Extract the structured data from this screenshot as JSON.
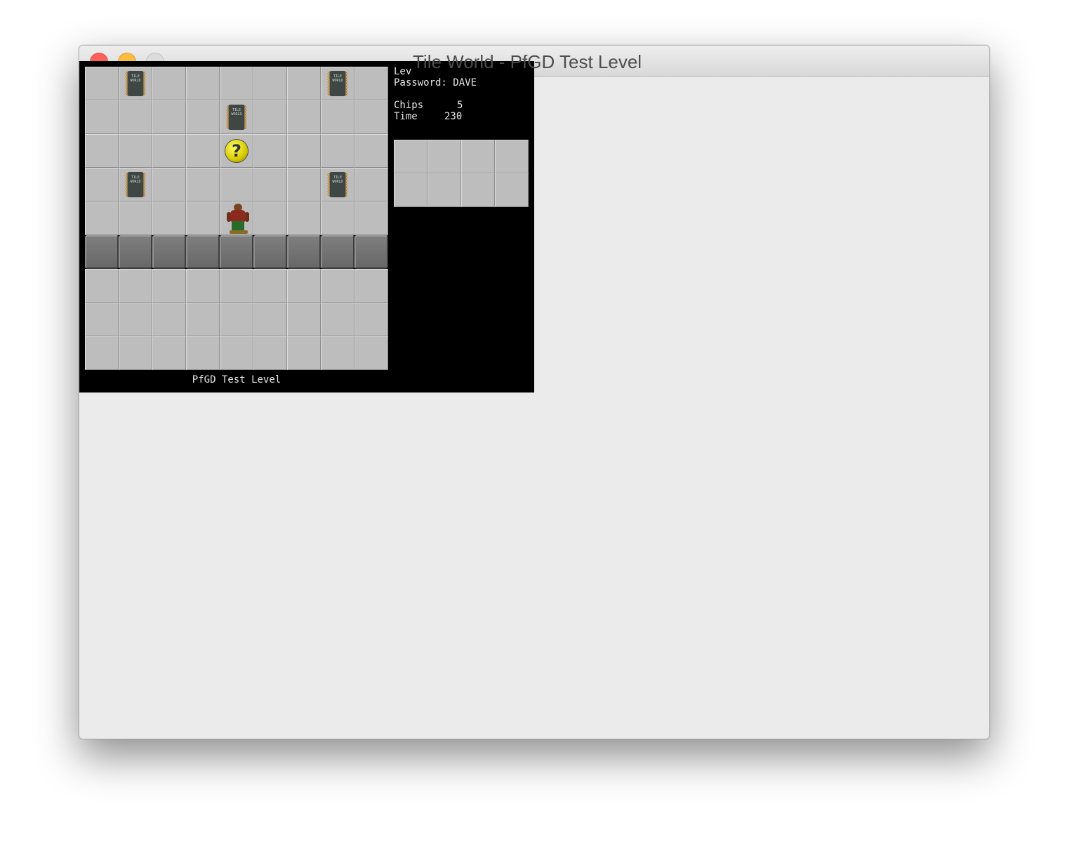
{
  "window": {
    "title": "Tile World - PfGD Test Level"
  },
  "sidebar": {
    "level_label": "Lev",
    "password_label": "Password:",
    "password_value": "DAVE",
    "chips_label": "Chips",
    "chips_value": "5",
    "time_label": "Time",
    "time_value": "230"
  },
  "board": {
    "level_name": "PfGD Test Level",
    "chip_text": "TILE WORLD",
    "hint_symbol": "?",
    "rows": [
      [
        "floor",
        "chip",
        "floor",
        "floor",
        "floor",
        "floor",
        "floor",
        "chip",
        "floor"
      ],
      [
        "floor",
        "floor",
        "floor",
        "floor",
        "chip",
        "floor",
        "floor",
        "floor",
        "floor"
      ],
      [
        "floor",
        "floor",
        "floor",
        "floor",
        "hint",
        "floor",
        "floor",
        "floor",
        "floor"
      ],
      [
        "floor",
        "chip",
        "floor",
        "floor",
        "floor",
        "floor",
        "floor",
        "chip",
        "floor"
      ],
      [
        "floor",
        "floor",
        "floor",
        "floor",
        "player",
        "floor",
        "floor",
        "floor",
        "floor"
      ],
      [
        "wall",
        "wall",
        "wall",
        "wall",
        "wall",
        "wall",
        "wall",
        "wall",
        "wall"
      ],
      [
        "floor",
        "floor",
        "floor",
        "floor",
        "floor",
        "floor",
        "floor",
        "floor",
        "floor"
      ],
      [
        "floor",
        "floor",
        "floor",
        "floor",
        "floor",
        "floor",
        "floor",
        "floor",
        "floor"
      ],
      [
        "floor",
        "floor",
        "floor",
        "floor",
        "floor",
        "floor",
        "floor",
        "floor",
        "floor"
      ]
    ]
  },
  "inventory": {
    "slots": [
      "empty",
      "empty",
      "empty",
      "empty",
      "empty",
      "empty",
      "empty",
      "empty"
    ]
  },
  "colors": {
    "close": "#fc605c",
    "minimize": "#fdbc40",
    "zoom": "#dcdcdc",
    "floor": "#bdbdbd",
    "wall": "#747474"
  }
}
